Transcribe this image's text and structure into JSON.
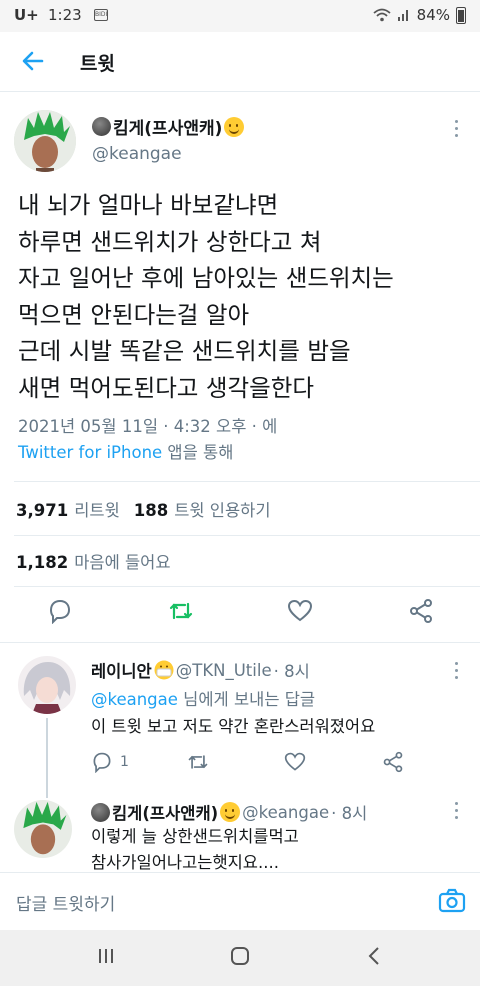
{
  "status_bar": {
    "carrier": "U+",
    "time": "1:23",
    "sim_label": "BIDI",
    "battery": "84%",
    "battery_level": 0.84,
    "icons": [
      "wifi-icon",
      "signal-icon",
      "battery-icon"
    ]
  },
  "header": {
    "title": "트윗",
    "back_icon": "arrow-left-icon"
  },
  "main_tweet": {
    "name": "킴게(프사앤캐)",
    "handle": "@keangae",
    "lines": [
      "내 뇌가 얼마나 바보같냐면",
      "하루면 샌드위치가 상한다고 쳐",
      "자고 일어난 후에 남아있는 샌드위치는",
      "먹으면 안된다는걸 알아",
      "근데 시발 똑같은 샌드위치를 밤을",
      "새면 먹어도된다고 생각을한다"
    ],
    "timestamp": "2021년 05월 11일 · 4:32 오후 · 에",
    "source_app": "Twitter for iPhone",
    "source_suffix": " 앱을 통해",
    "retweets_count": "3,971",
    "retweets_label": "리트윗",
    "quotes_count": "188",
    "quotes_label": "트윗 인용하기",
    "likes_count": "1,182",
    "likes_label": "마음에 들어요"
  },
  "replies": [
    {
      "name": "레이니안",
      "handle": "@TKN_Utile",
      "age": "· 8시",
      "reply_prefix": "@keangae",
      "reply_suffix": " 님에게 보내는 답글",
      "text": "이 트윗 보고 저도 약간 혼란스러워졌어요",
      "reply_count": "1"
    },
    {
      "name": "킴게(프사앤캐)",
      "handle": "@keangae",
      "age": "· 8시",
      "lines": [
        "이렇게 늘 상한샌드위치를먹고",
        "참사가일어나고는햇지요...."
      ]
    }
  ],
  "composer": {
    "placeholder": "답글 트윗하기",
    "camera_icon": "camera-icon"
  },
  "nav_bar": {
    "icons": [
      "recents-icon",
      "home-icon",
      "back-icon"
    ]
  },
  "colors": {
    "accent": "#1da1f2",
    "retweet_green": "#17bf63",
    "secondary_text": "#657786",
    "divider": "#e6ecf0"
  }
}
